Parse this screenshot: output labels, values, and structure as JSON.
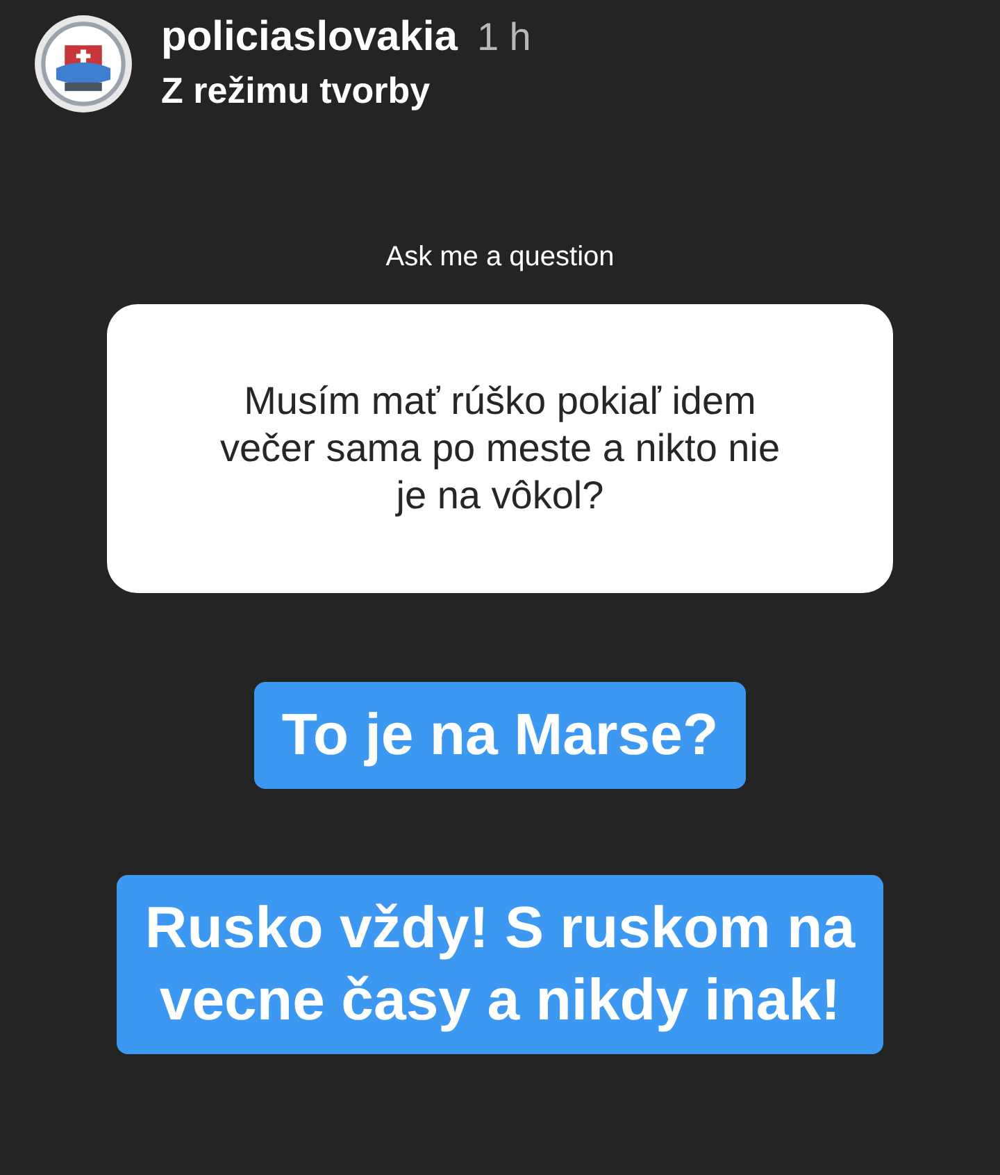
{
  "story_header": {
    "username": "policiaslovakia",
    "time": "1 h",
    "subtitle": "Z režimu tvorby"
  },
  "question_sticker": {
    "prompt": "Ask me a question",
    "question": "Musím mať rúško pokiaľ idem\nvečer sama po meste a nikto nie\nje na vôkol?"
  },
  "text_stickers": [
    {
      "text": "To je na Marse?"
    },
    {
      "text": "Rusko vždy! S ruskom na\nvecne časy a nikdy inak!"
    }
  ]
}
